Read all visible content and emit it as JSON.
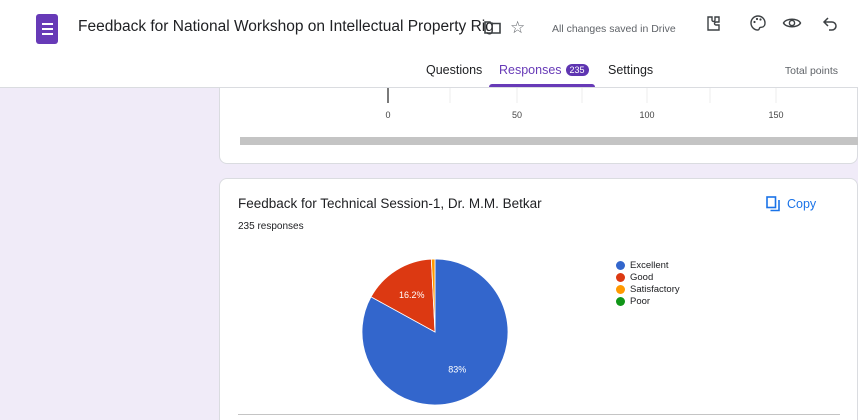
{
  "header": {
    "title": "Feedback  for National Workshop on Intellectual Property Rig",
    "saved_status": "All changes saved in Drive",
    "icons": [
      "forms-app-icon",
      "folder-icon",
      "star-icon",
      "customize-theme-icon",
      "palette-icon",
      "preview-icon",
      "undo-icon"
    ]
  },
  "tabs": {
    "questions": "Questions",
    "responses": "Responses",
    "responses_count": "235",
    "settings": "Settings",
    "total_points": "Total points"
  },
  "prev_chart": {
    "tick_labels": [
      "0",
      "50",
      "100",
      "150"
    ]
  },
  "question": {
    "title": "Feedback for Technical Session-1, Dr. M.M. Betkar",
    "responses": "235 responses",
    "copy_label": "Copy"
  },
  "chart_data": {
    "type": "pie",
    "title": "Feedback for Technical Session-1, Dr. M.M. Betkar",
    "labels": [
      "Excellent",
      "Good",
      "Satisfactory",
      "Poor"
    ],
    "values": [
      83,
      16.2,
      0.8,
      0
    ],
    "slice_labels": [
      "83%",
      "16.2%",
      "",
      ""
    ],
    "colors": [
      "#3366cc",
      "#dc3912",
      "#ff9900",
      "#109618"
    ],
    "legend_position": "right"
  }
}
